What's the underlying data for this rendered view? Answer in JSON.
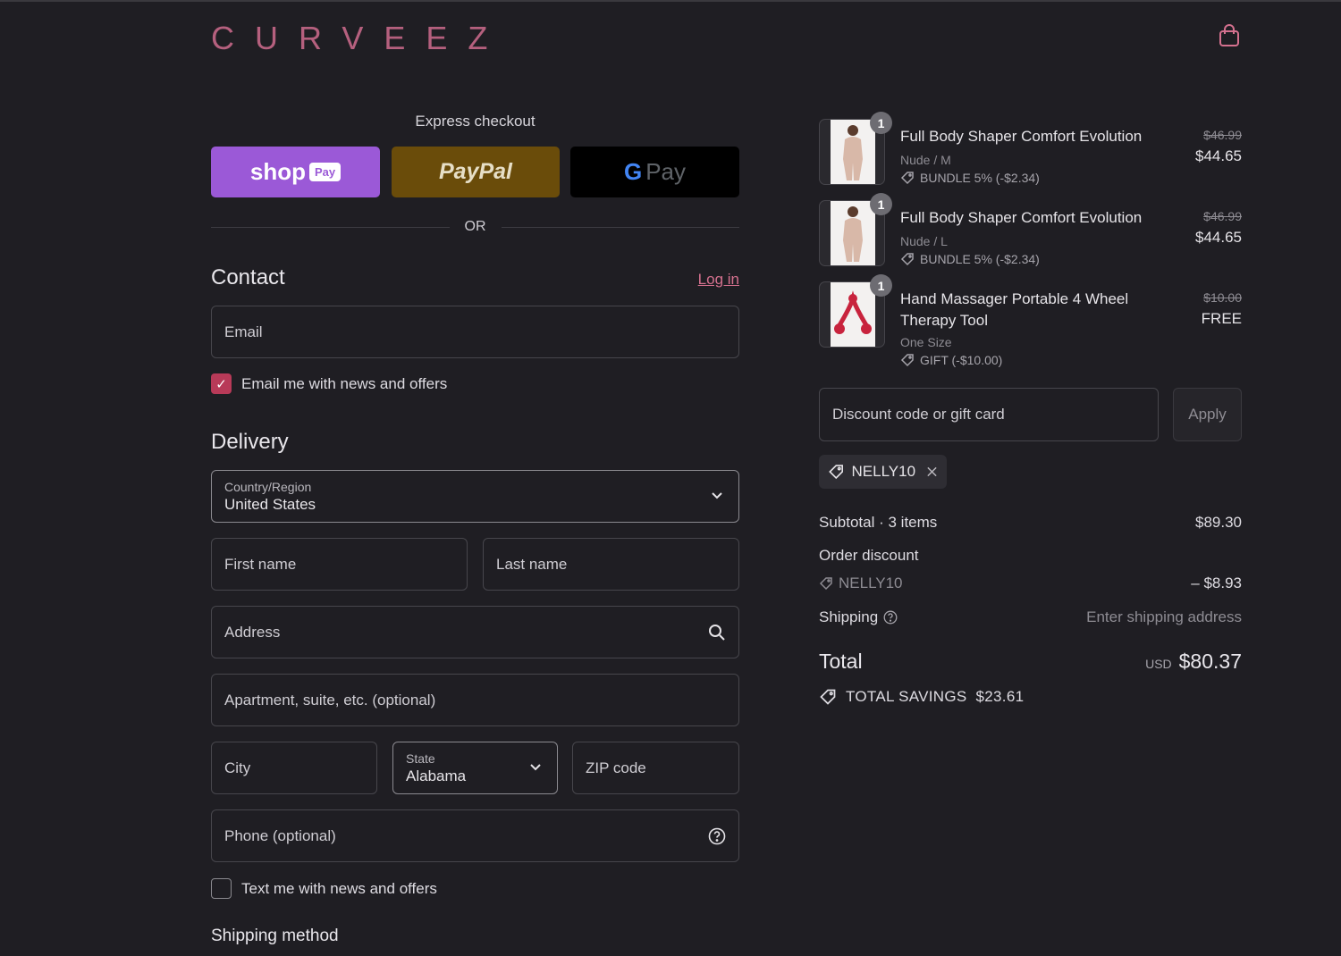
{
  "header": {
    "logo": "CURVEEZ",
    "cart_icon": "shopping-bag-icon"
  },
  "express": {
    "title": "Express checkout",
    "shop_pay": {
      "label": "shop",
      "pill": "Pay"
    },
    "paypal": "PayPal",
    "gpay": {
      "g": "G",
      "label": "Pay"
    },
    "or": "OR"
  },
  "contact": {
    "title": "Contact",
    "login": "Log in",
    "email_placeholder": "Email",
    "news_label": "Email me with news and offers",
    "news_checked": true
  },
  "delivery": {
    "title": "Delivery",
    "country_label": "Country/Region",
    "country_value": "United States",
    "first_name": "First name",
    "last_name": "Last name",
    "address": "Address",
    "apartment": "Apartment, suite, etc. (optional)",
    "city": "City",
    "state_label": "State",
    "state_value": "Alabama",
    "zip": "ZIP code",
    "phone": "Phone (optional)",
    "text_label": "Text me with news and offers",
    "text_checked": false,
    "shipping_method_title": "Shipping method"
  },
  "summary": {
    "items": [
      {
        "qty": "1",
        "name": "Full Body Shaper Comfort Evolution",
        "variant": "Nude / M",
        "discount": "BUNDLE 5% (-$2.34)",
        "old_price": "$46.99",
        "price": "$44.65"
      },
      {
        "qty": "1",
        "name": "Full Body Shaper Comfort Evolution",
        "variant": "Nude / L",
        "discount": "BUNDLE 5% (-$2.34)",
        "old_price": "$46.99",
        "price": "$44.65"
      },
      {
        "qty": "1",
        "name": "Hand Massager Portable 4 Wheel Therapy Tool",
        "variant": "One Size",
        "discount": "GIFT (-$10.00)",
        "old_price": "$10.00",
        "price": "FREE"
      }
    ],
    "discount_placeholder": "Discount code or gift card",
    "apply": "Apply",
    "applied_code": "NELLY10",
    "subtotal_label": "Subtotal · 3 items",
    "subtotal_value": "$89.30",
    "order_discount_label": "Order discount",
    "order_discount_code": "NELLY10",
    "order_discount_value": "– $8.93",
    "shipping_label": "Shipping",
    "shipping_value": "Enter shipping address",
    "total_label": "Total",
    "total_currency": "USD",
    "total_value": "$80.37",
    "savings_label": "TOTAL SAVINGS",
    "savings_value": "$23.61"
  },
  "colors": {
    "background": "#1f1e23",
    "accent": "#b83a58",
    "brand": "#b5607e",
    "shop_pay": "#9b59d7",
    "paypal": "#6a4c0a"
  }
}
